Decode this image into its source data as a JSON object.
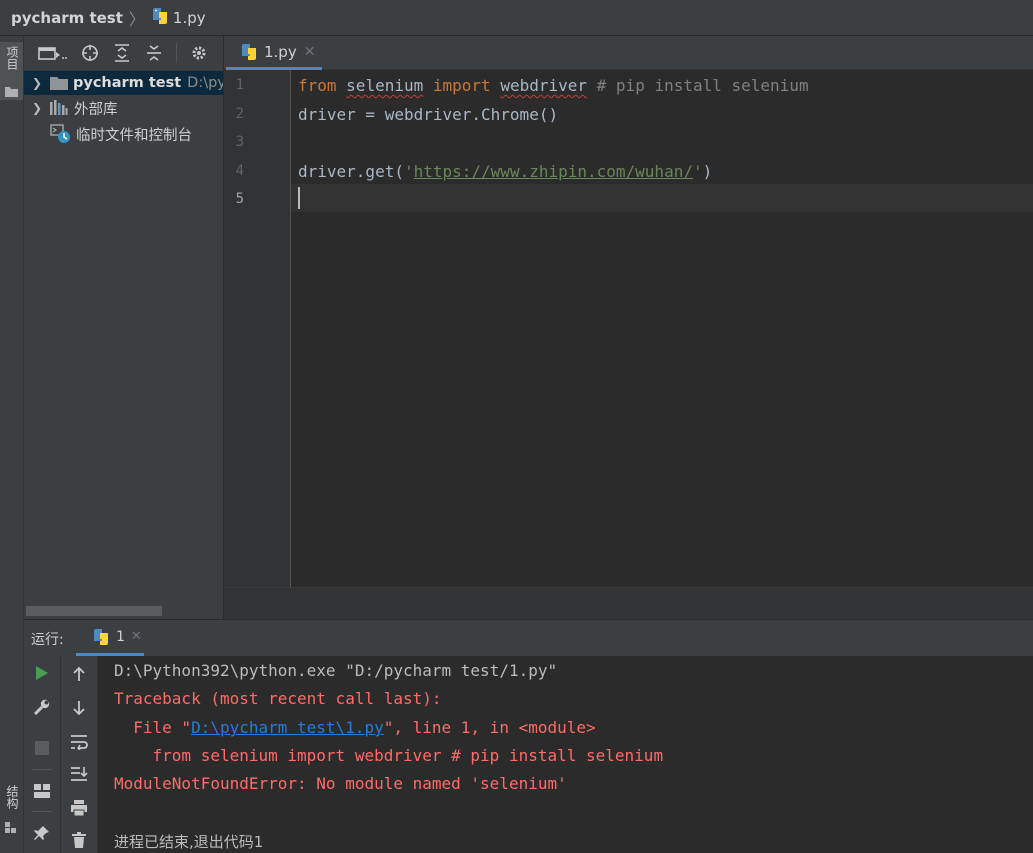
{
  "breadcrumb": {
    "project": "pycharm test",
    "file": "1.py"
  },
  "left_stripe": {
    "project_label": "项目",
    "structure_label": "结构"
  },
  "project_panel": {
    "tree": [
      {
        "label": "pycharm test",
        "path": "D:\\py",
        "icon": "folder-icon",
        "selected": true
      },
      {
        "label": "外部库",
        "icon": "library-icon"
      },
      {
        "label": "临时文件和控制台",
        "icon": "scratches-icon"
      }
    ]
  },
  "editor": {
    "tab_label": "1.py",
    "line_numbers": [
      "1",
      "2",
      "3",
      "4",
      "5"
    ],
    "code": {
      "l1_from": "from",
      "l1_mod": "selenium",
      "l1_import": "import",
      "l1_name": "webdriver",
      "l1_comment": "# pip install selenium",
      "l2": "driver = webdriver.Chrome()",
      "l4_pre": "driver.get(",
      "l4_q1": "'",
      "l4_url": "https://www.zhipin.com/wuhan/",
      "l4_q2": "'",
      "l4_post": ")"
    }
  },
  "run_panel": {
    "label": "运行:",
    "tab_label": "1",
    "console": {
      "cmd": "D:\\Python392\\python.exe \"D:/pycharm test/1.py\"",
      "traceback": "Traceback (most recent call last):",
      "file_pre": "  File \"",
      "file_link": "D:\\pycharm test\\1.py",
      "file_post": "\", line 1, in <module>",
      "src_line": "    from selenium import webdriver # pip install selenium",
      "error": "ModuleNotFoundError: No module named 'selenium'",
      "exit": "进程已结束,退出代码1"
    }
  },
  "colors": {
    "accent": "#4a88c7",
    "keyword": "#cc7832",
    "string": "#6a8759",
    "error": "#ff6b68",
    "link": "#287bde",
    "run_green": "#499c54"
  }
}
